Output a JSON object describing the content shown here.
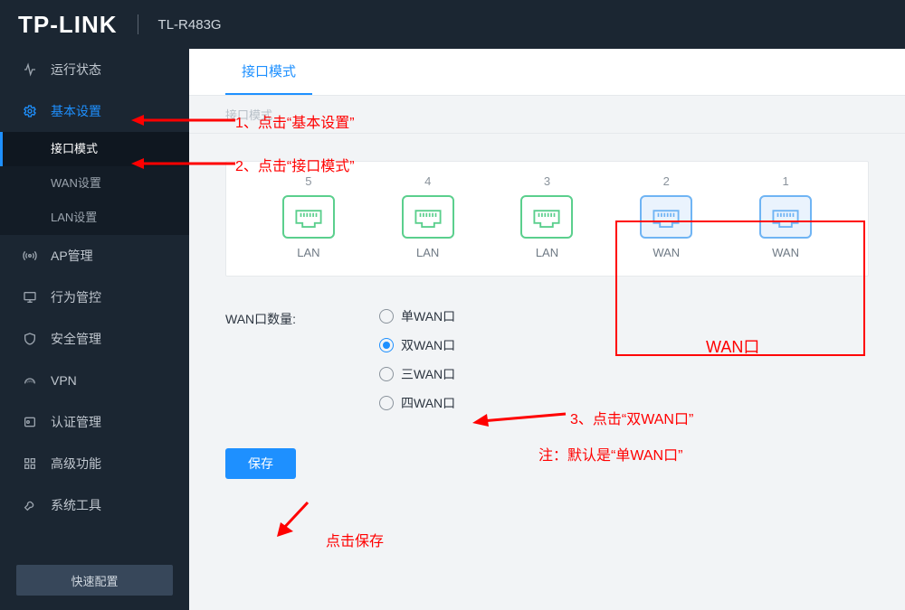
{
  "header": {
    "brand": "TP-LINK",
    "model": "TL-R483G"
  },
  "sidebar": {
    "items": [
      {
        "label": "运行状态",
        "icon": "activity"
      },
      {
        "label": "基本设置",
        "icon": "gear",
        "active": true
      },
      {
        "label": "AP管理",
        "icon": "antenna"
      },
      {
        "label": "行为管控",
        "icon": "monitor"
      },
      {
        "label": "安全管理",
        "icon": "shield"
      },
      {
        "label": "VPN",
        "icon": "vpn"
      },
      {
        "label": "认证管理",
        "icon": "auth"
      },
      {
        "label": "高级功能",
        "icon": "grid"
      },
      {
        "label": "系统工具",
        "icon": "wrench"
      }
    ],
    "sub": [
      {
        "label": "接口模式",
        "active": true
      },
      {
        "label": "WAN设置"
      },
      {
        "label": "LAN设置"
      }
    ],
    "quick": "快速配置"
  },
  "tab": {
    "label": "接口模式"
  },
  "breadcrumb": "接口模式",
  "ports": [
    {
      "num": "5",
      "label": "LAN",
      "type": "lan"
    },
    {
      "num": "4",
      "label": "LAN",
      "type": "lan"
    },
    {
      "num": "3",
      "label": "LAN",
      "type": "lan"
    },
    {
      "num": "2",
      "label": "WAN",
      "type": "wan"
    },
    {
      "num": "1",
      "label": "WAN",
      "type": "wan"
    }
  ],
  "form": {
    "label": "WAN口数量:",
    "options": [
      "单WAN口",
      "双WAN口",
      "三WAN口",
      "四WAN口"
    ],
    "selected": 1
  },
  "save": "保存",
  "annotations": {
    "step1": "1、点击“基本设置”",
    "step2": "2、点击“接口模式”",
    "step3a": "3、点击“双WAN口”",
    "step3b": "注：默认是“单WAN口”",
    "wanbox": "WAN口",
    "save": "点击保存"
  }
}
